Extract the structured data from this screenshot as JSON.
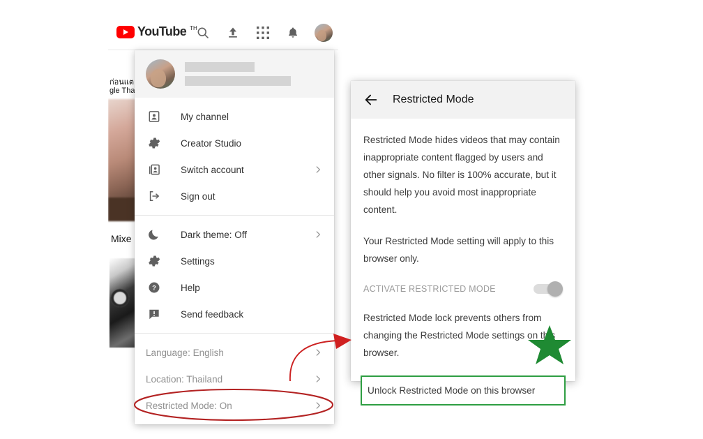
{
  "background": {
    "brand": {
      "logo_icon": "youtube-logo-icon",
      "wordmark": "YouTube",
      "country_code": "TH"
    },
    "topbar_icons": [
      {
        "name": "search-icon",
        "label": "Search"
      },
      {
        "name": "upload-icon",
        "label": "Upload"
      },
      {
        "name": "apps-grid-icon",
        "label": "YouTube apps"
      },
      {
        "name": "notifications-bell-icon",
        "label": "Notifications"
      },
      {
        "name": "account-avatar",
        "label": "Account"
      }
    ],
    "feed_text_line1": "ก่อนแต",
    "feed_text_line2": "gle Tha",
    "feed_mix_label": "Mixe"
  },
  "account_menu": {
    "header": {
      "avatar_name": "account-avatar",
      "name_redacted": true
    },
    "sections": [
      {
        "muted": false,
        "items": [
          {
            "label": "My channel",
            "icon": "person-card-icon",
            "has_arrow": false
          },
          {
            "label": "Creator Studio",
            "icon": "gear-icon",
            "has_arrow": false
          },
          {
            "label": "Switch account",
            "icon": "switch-account-icon",
            "has_arrow": true
          },
          {
            "label": "Sign out",
            "icon": "sign-out-icon",
            "has_arrow": false
          }
        ]
      },
      {
        "muted": false,
        "items": [
          {
            "label": "Dark theme: Off",
            "icon": "moon-icon",
            "has_arrow": true
          },
          {
            "label": "Settings",
            "icon": "gear-icon",
            "has_arrow": false
          },
          {
            "label": "Help",
            "icon": "help-question-icon",
            "has_arrow": false
          },
          {
            "label": "Send feedback",
            "icon": "feedback-icon",
            "has_arrow": false
          }
        ]
      },
      {
        "muted": true,
        "items": [
          {
            "label": "Language: English",
            "icon": "",
            "has_arrow": true
          },
          {
            "label": "Location: Thailand",
            "icon": "",
            "has_arrow": true
          },
          {
            "label": "Restricted Mode: On",
            "icon": "",
            "has_arrow": true
          }
        ]
      }
    ]
  },
  "restricted_panel": {
    "back_icon": "back-arrow-icon",
    "title": "Restricted Mode",
    "paragraph1": "Restricted Mode hides videos that may contain inappropriate content flagged by users and other signals. No filter is 100% accurate, but it should help you avoid most inappropriate content.",
    "paragraph2": "Your Restricted Mode setting will apply to this browser only.",
    "toggle_label": "ACTIVATE RESTRICTED MODE",
    "toggle_state": "on",
    "paragraph3": "Restricted Mode lock prevents others from changing the Restricted Mode settings on this browser.",
    "unlock_label": "Unlock Restricted Mode on this browser"
  },
  "annotations": {
    "ellipse_color": "#b32222",
    "arrow_color": "#cc2222",
    "highlight_box_color": "#2e9e42",
    "star_color": "#1f8a33",
    "ellipse_target": "Restricted Mode: On",
    "highlight_target": "Unlock Restricted Mode on this browser"
  }
}
